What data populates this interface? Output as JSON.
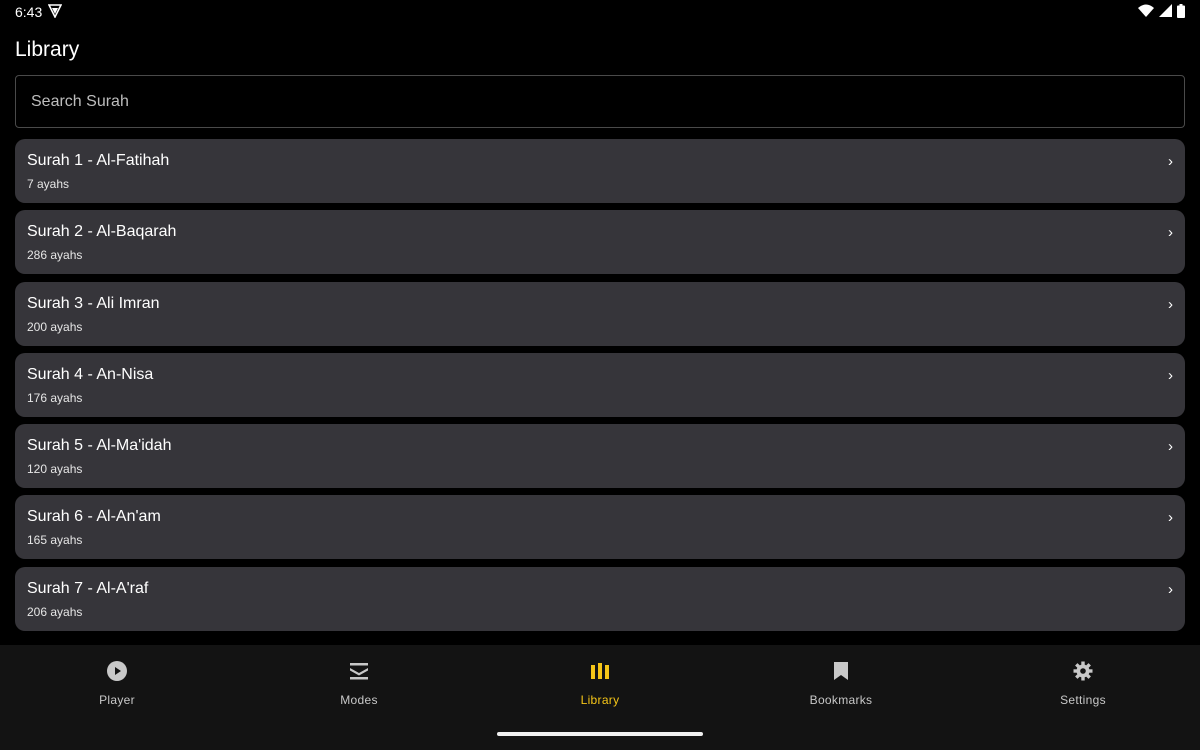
{
  "status_bar": {
    "time": "6:43",
    "icons": [
      "vpn-shield-icon",
      "wifi-icon",
      "cellular-signal-icon",
      "battery-icon"
    ]
  },
  "page": {
    "title": "Library"
  },
  "search": {
    "placeholder": "Search Surah",
    "value": ""
  },
  "surahs": [
    {
      "title": "Surah 1 - Al-Fatihah",
      "ayahs": "7 ayahs"
    },
    {
      "title": "Surah 2 - Al-Baqarah",
      "ayahs": "286 ayahs"
    },
    {
      "title": "Surah 3 - Ali Imran",
      "ayahs": "200 ayahs"
    },
    {
      "title": "Surah 4 - An-Nisa",
      "ayahs": "176 ayahs"
    },
    {
      "title": "Surah 5 - Al-Ma'idah",
      "ayahs": "120 ayahs"
    },
    {
      "title": "Surah 6 - Al-An'am",
      "ayahs": "165 ayahs"
    },
    {
      "title": "Surah 7 - Al-A'raf",
      "ayahs": "206 ayahs"
    }
  ],
  "chevron": "›",
  "nav": {
    "active": "Library",
    "items": [
      {
        "label": "Player",
        "icon": "play-circle-icon"
      },
      {
        "label": "Modes",
        "icon": "modes-stack-icon"
      },
      {
        "label": "Library",
        "icon": "library-icon"
      },
      {
        "label": "Bookmarks",
        "icon": "bookmark-icon"
      },
      {
        "label": "Settings",
        "icon": "gear-icon"
      }
    ]
  },
  "colors": {
    "accent": "#f5c518",
    "card": "#36353a",
    "nav_bg": "#131313",
    "background": "#000000"
  }
}
